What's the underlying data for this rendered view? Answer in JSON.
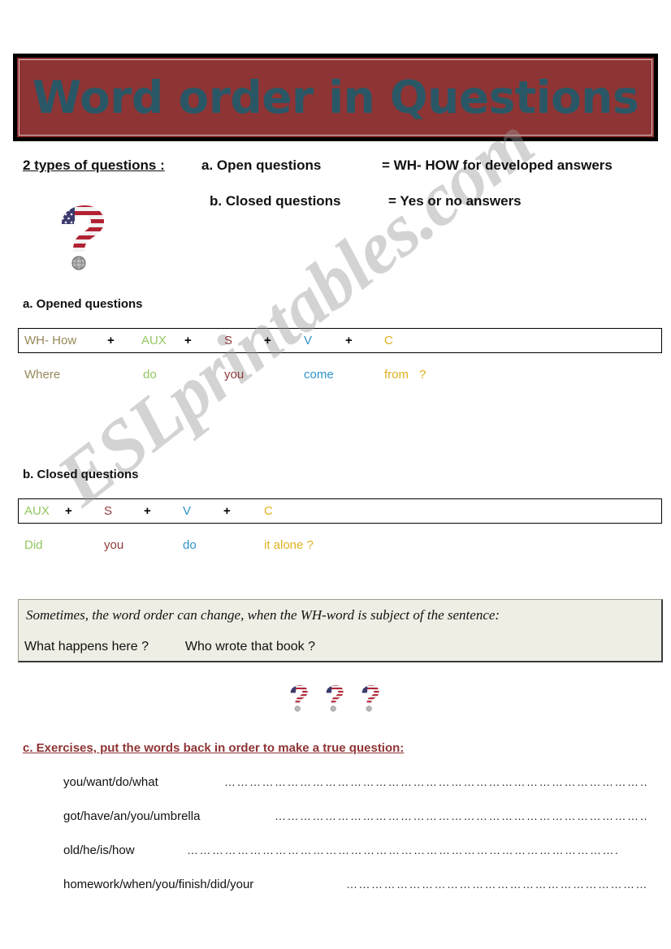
{
  "page": {
    "title": "Word order in Questions",
    "banner_bg": "#8F3434",
    "banner_text_color": "#2A5766",
    "watermark": "ESLprintables.com"
  },
  "intro": {
    "label": "2 types of questions :",
    "type_a_label": "a. Open questions",
    "type_a_value": "= WH- HOW for developed answers",
    "type_b_label": "b. Closed questions",
    "type_b_value": "= Yes or no answers",
    "icon": "flag-question-mark-icon"
  },
  "open_section": {
    "heading": "a. Opened questions",
    "pattern": [
      {
        "token": "WH- How",
        "role": "wh",
        "color": "#97885A"
      },
      {
        "token": "+",
        "role": "plus",
        "color": "#000000"
      },
      {
        "token": "AUX",
        "role": "aux",
        "color": "#93C760"
      },
      {
        "token": "+",
        "role": "plus",
        "color": "#000000"
      },
      {
        "token": "S",
        "role": "s",
        "color": "#8F3B3B"
      },
      {
        "token": "+",
        "role": "plus",
        "color": "#000000"
      },
      {
        "token": "V",
        "role": "v",
        "color": "#2E93C9"
      },
      {
        "token": "+",
        "role": "plus",
        "color": "#000000"
      },
      {
        "token": "C",
        "role": "c",
        "color": "#E0B020"
      }
    ],
    "example": [
      {
        "word": "Where",
        "role": "wh",
        "color": "#97885A"
      },
      {
        "word": "do",
        "role": "aux",
        "color": "#93C760"
      },
      {
        "word": "you",
        "role": "s",
        "color": "#8F3B3B"
      },
      {
        "word": "come",
        "role": "v",
        "color": "#2E93C9"
      },
      {
        "word": "from",
        "role": "c",
        "color": "#E0B020"
      },
      {
        "word": "?",
        "role": "c",
        "color": "#E0B020"
      }
    ]
  },
  "closed_section": {
    "heading": "b. Closed questions",
    "pattern": [
      {
        "token": "AUX",
        "role": "aux",
        "color": "#93C760"
      },
      {
        "token": "+",
        "role": "plus",
        "color": "#000000"
      },
      {
        "token": "S",
        "role": "s",
        "color": "#8F3B3B"
      },
      {
        "token": "+",
        "role": "plus",
        "color": "#000000"
      },
      {
        "token": "V",
        "role": "v",
        "color": "#2E93C9"
      },
      {
        "token": "+",
        "role": "plus",
        "color": "#000000"
      },
      {
        "token": "C",
        "role": "c",
        "color": "#E0B020"
      }
    ],
    "example": [
      {
        "word": "Did",
        "role": "aux",
        "color": "#93C760"
      },
      {
        "word": "you",
        "role": "s",
        "color": "#8F3B3B"
      },
      {
        "word": "do",
        "role": "v",
        "color": "#2E93C9"
      },
      {
        "word": "it alone ?",
        "role": "c",
        "color": "#E0B020"
      }
    ]
  },
  "note": {
    "line_1": "Sometimes, the word order can change, when the WH-word is subject of the sentence:",
    "line_2_a": "What happens here ?",
    "line_2_b": "Who wrote that book ?",
    "bg_color": "#EEEEE4"
  },
  "decor": {
    "flag_question_marks": [
      "flag-question-mark-icon",
      "flag-question-mark-icon",
      "flag-question-mark-icon"
    ]
  },
  "exercises": {
    "heading": "c. Exercises, put the words back in order to make a true question:",
    "items": [
      {
        "prompt": "you/want/do/what",
        "answer_line": "……………………………………………………………………………………………"
      },
      {
        "prompt": "got/have/an/you/umbrella",
        "answer_line": "………………………………………………………………………………."
      },
      {
        "prompt": "old/he/is/how",
        "answer_line": "…………………………………………………………………………………………."
      },
      {
        "prompt": "homework/when/you/finish/did/your",
        "answer_line": "……………………………………………………………………."
      }
    ]
  }
}
